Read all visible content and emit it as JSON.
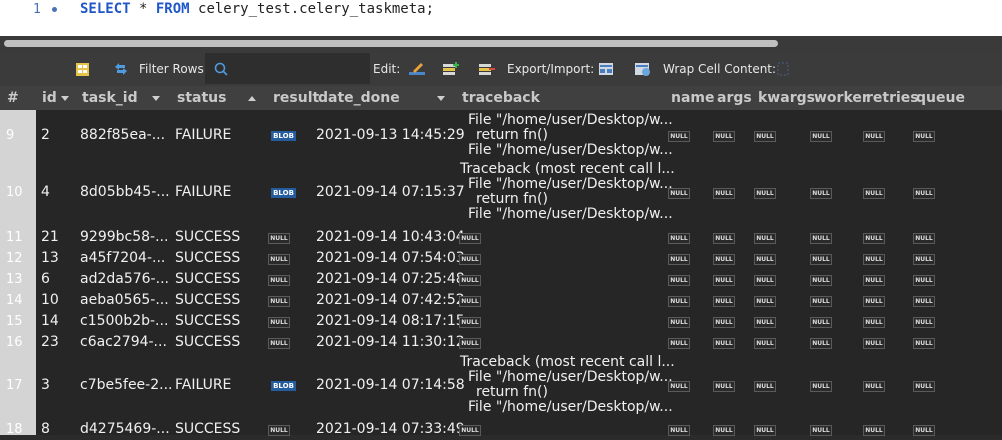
{
  "editor": {
    "line_number": "1",
    "query_kw1": "SELECT",
    "query_mid": " * ",
    "query_kw2": "FROM",
    "query_rest": " celery_test.celery_taskmeta;"
  },
  "toolbar": {
    "filter_label": "Filter Rows:",
    "edit_label": "Edit:",
    "export_label": "Export/Import:",
    "wrap_label": "Wrap Cell Content:"
  },
  "columns": {
    "rownum": "#",
    "id": "id",
    "task_id": "task_id",
    "status": "status",
    "result": "result",
    "date_done": "date_done",
    "traceback": "traceback",
    "name": "name",
    "args": "args",
    "kwargs": "kwargs",
    "worker": "worker",
    "retries": "retries",
    "queue": "queue"
  },
  "badges": {
    "null": "NULL",
    "blob": "BLOB"
  },
  "rows": [
    {
      "rownum": "9",
      "id": "2",
      "task_id": "882f85ea-...",
      "status": "FAILURE",
      "date_done": "2021-09-13 14:45:29",
      "traceback": [
        "File \"/home/user/Desktop/w...",
        "return fn()",
        "File \"/home/user/Desktop/w..."
      ]
    },
    {
      "rownum": "10",
      "id": "4",
      "task_id": "8d05bb45-...",
      "status": "FAILURE",
      "date_done": "2021-09-14 07:15:37",
      "traceback": [
        "Traceback (most recent call l...",
        "File \"/home/user/Desktop/w...",
        "return fn()",
        "File \"/home/user/Desktop/w..."
      ]
    },
    {
      "rownum": "11",
      "id": "21",
      "task_id": "9299bc58-...",
      "status": "SUCCESS",
      "date_done": "2021-09-14 10:43:04"
    },
    {
      "rownum": "12",
      "id": "13",
      "task_id": "a45f7204-...",
      "status": "SUCCESS",
      "date_done": "2021-09-14 07:54:03"
    },
    {
      "rownum": "13",
      "id": "6",
      "task_id": "ad2da576-...",
      "status": "SUCCESS",
      "date_done": "2021-09-14 07:25:48"
    },
    {
      "rownum": "14",
      "id": "10",
      "task_id": "aeba0565-...",
      "status": "SUCCESS",
      "date_done": "2021-09-14 07:42:52"
    },
    {
      "rownum": "15",
      "id": "14",
      "task_id": "c1500b2b-...",
      "status": "SUCCESS",
      "date_done": "2021-09-14 08:17:15"
    },
    {
      "rownum": "16",
      "id": "23",
      "task_id": "c6ac2794-...",
      "status": "SUCCESS",
      "date_done": "2021-09-14 11:30:12"
    },
    {
      "rownum": "17",
      "id": "3",
      "task_id": "c7be5fee-2...",
      "status": "FAILURE",
      "date_done": "2021-09-14 07:14:58",
      "traceback": [
        "Traceback (most recent call l...",
        "File \"/home/user/Desktop/w...",
        "return fn()",
        "File \"/home/user/Desktop/w..."
      ]
    },
    {
      "rownum": "18",
      "id": "8",
      "task_id": "d4275469-...",
      "status": "SUCCESS",
      "date_done": "2021-09-14 07:33:49"
    }
  ]
}
